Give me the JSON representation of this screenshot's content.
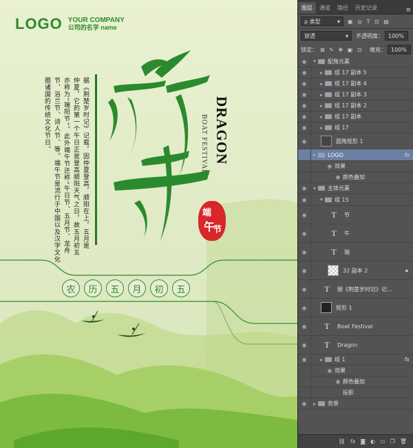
{
  "poster": {
    "logo": "LOGO",
    "company_en": "YOUR COMPANY",
    "company_cn": "公司的名字 name",
    "body_columns": [
      "据《荆楚岁时记》记载，因仲夏登高，顺阳在上，五月是",
      "仲夏，它的第一个午日正是登高顺阳天气之日，故五月初五",
      "亦称为“端阳节”。此外端午节还称“午日节、五月节、龙舟",
      "节、浴兰节、诗人节、等。端午节是流行于中国以及汉字文化",
      "圈诸国的传统文化节日。"
    ],
    "dragon": "DRAGON",
    "boat_festival": "BOAT FESTIVAL",
    "seal_chars": [
      "端",
      "午",
      "节"
    ],
    "lunar_date": [
      "农",
      "历",
      "五",
      "月",
      "初",
      "五"
    ]
  },
  "panel": {
    "tabs": [
      "图层",
      "通道",
      "路径",
      "历史记录"
    ],
    "menu_icon": "≡",
    "filter_label": "ρ 类型",
    "filter_icons": "▣ ◎ T ⊡ ▤",
    "blend_mode": "穿透",
    "opacity_label": "不透明度：",
    "opacity_value": "100%",
    "lock_label": "锁定：",
    "lock_icons": "⊠ ✎ ✥ ▣ ⊡",
    "fill_label": "填充：",
    "fill_value": "100%",
    "layers": [
      {
        "name": "配角元素",
        "type": "group",
        "expanded": true
      },
      {
        "name": "组 17 副本 5",
        "type": "group"
      },
      {
        "name": "组 17 副本 4",
        "type": "group"
      },
      {
        "name": "组 17 副本 3",
        "type": "group"
      },
      {
        "name": "组 17 副本 2",
        "type": "group"
      },
      {
        "name": "组 17 副本",
        "type": "group"
      },
      {
        "name": "组 17",
        "type": "group"
      },
      {
        "name": "圆角矩形 1",
        "type": "shape"
      },
      {
        "name": "LOGO",
        "type": "group",
        "fx": "fx",
        "selected": true
      },
      {
        "name": "效果",
        "type": "effect"
      },
      {
        "name": "颜色叠加",
        "type": "effect-item"
      },
      {
        "name": "主体元素",
        "type": "group",
        "expanded": true
      },
      {
        "name": "组 15",
        "type": "group",
        "expanded": true
      },
      {
        "name": "节",
        "type": "text"
      },
      {
        "name": "午",
        "type": "text"
      },
      {
        "name": "端",
        "type": "text"
      },
      {
        "name": "32 副本 2",
        "type": "image",
        "lock": true
      },
      {
        "name": "据《荆楚岁时记》记...",
        "type": "text"
      },
      {
        "name": "矩形 1",
        "type": "shape"
      },
      {
        "name": "Boat Festival",
        "type": "text"
      },
      {
        "name": "Dragon",
        "type": "text"
      },
      {
        "name": "组 1",
        "type": "group",
        "fx": "fx"
      },
      {
        "name": "效果",
        "type": "effect"
      },
      {
        "name": "颜色叠加",
        "type": "effect-item"
      },
      {
        "name": "投影",
        "type": "effect-item"
      },
      {
        "name": "背景",
        "type": "group"
      }
    ],
    "footer_icons": [
      "link-icon",
      "fx-icon",
      "mask-icon",
      "adjustment-icon",
      "folder-icon",
      "new-layer-icon",
      "trash-icon"
    ]
  },
  "colors": {
    "brand_green": "#2a8c2e",
    "seal_red": "#d8262a",
    "panel_bg": "#535353",
    "selected": "#6b7fa3"
  }
}
